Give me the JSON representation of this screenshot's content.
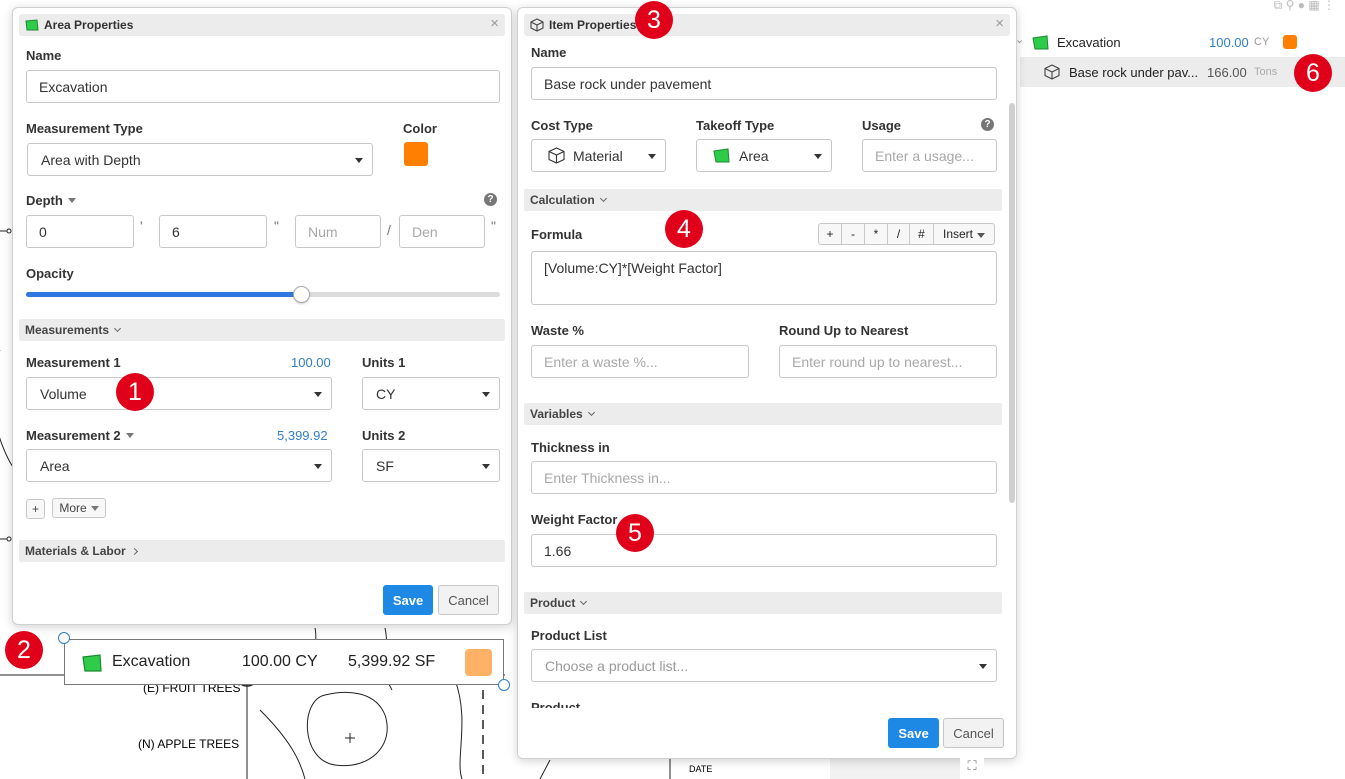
{
  "colors": {
    "accent": "#1e88e5",
    "area_color": "#ff8000",
    "area_color_light": "#ffb265",
    "badge": "#e1001a",
    "area_icon": "#2fcc4a"
  },
  "badges": [
    "1",
    "2",
    "3",
    "4",
    "5",
    "6"
  ],
  "area_panel": {
    "title": "Area Properties",
    "name_label": "Name",
    "name_value": "Excavation",
    "measurement_type_label": "Measurement Type",
    "measurement_type_value": "Area with Depth",
    "color_label": "Color",
    "depth_label": "Depth",
    "depth_feet": "0",
    "feet_mark": "'",
    "depth_inches": "6",
    "inch_mark": "\"",
    "num_placeholder": "Num",
    "fraction_sep": "/",
    "den_placeholder": "Den",
    "opacity_label": "Opacity",
    "opacity_level": 0.58,
    "measurements_section": "Measurements",
    "measurement1_label": "Measurement 1",
    "measurement1_amount": "100.00",
    "measurement1_value": "Volume",
    "units1_label": "Units 1",
    "units1_value": "CY",
    "measurement2_label": "Measurement 2",
    "measurement2_amount": "5,399.92",
    "measurement2_value": "Area",
    "units2_label": "Units 2",
    "units2_value": "SF",
    "plus_label": "+",
    "more_label": "More",
    "materials_section": "Materials & Labor",
    "save_label": "Save",
    "cancel_label": "Cancel"
  },
  "item_panel": {
    "title": "Item Properties",
    "name_label": "Name",
    "name_value": "Base rock under pavement",
    "cost_type_label": "Cost Type",
    "cost_type_value": "Material",
    "takeoff_type_label": "Takeoff Type",
    "takeoff_type_value": "Area",
    "usage_label": "Usage",
    "usage_placeholder": "Enter a usage...",
    "calculation_section": "Calculation",
    "formula_label": "Formula",
    "formula_ops": [
      "+",
      "-",
      "*",
      "/",
      "#"
    ],
    "insert_label": "Insert",
    "formula_value": "[Volume:CY]*[Weight Factor]",
    "waste_label": "Waste %",
    "waste_placeholder": "Enter a waste %...",
    "roundup_label": "Round Up to Nearest",
    "roundup_placeholder": "Enter round up to nearest...",
    "variables_section": "Variables",
    "thickness_label": "Thickness in",
    "thickness_placeholder": "Enter Thickness in...",
    "weight_label": "Weight Factor",
    "weight_value": "1.66",
    "product_section": "Product",
    "product_list_label": "Product List",
    "product_list_placeholder": "Choose a product list...",
    "product_label": "Product",
    "save_label": "Save",
    "cancel_label": "Cancel"
  },
  "tree": {
    "row1_name": "Excavation",
    "row1_amount": "100.00",
    "row1_unit": "CY",
    "row2_name": "Base rock under pav...",
    "row2_amount": "166.00",
    "row2_unit": "Tons"
  },
  "canvas_label": {
    "name": "Excavation",
    "amount1": "100.00 CY",
    "amount2": "5,399.92 SF"
  },
  "drawing_text": {
    "fruit_trees": "(E) FRUIT TREES",
    "apple_trees": "(N) APPLE TREES",
    "date": "DATE"
  }
}
